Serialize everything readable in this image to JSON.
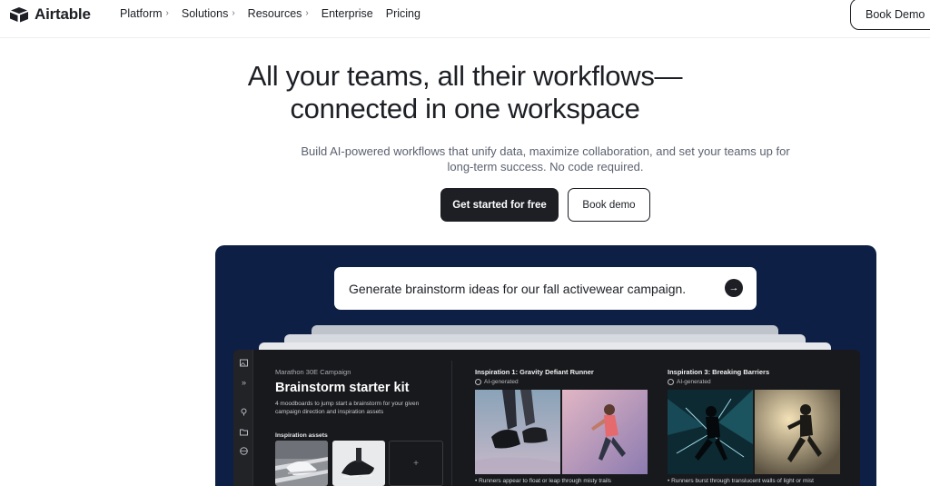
{
  "nav": {
    "logo_text": "Airtable",
    "items": [
      {
        "label": "Platform",
        "has_chevron": true
      },
      {
        "label": "Solutions",
        "has_chevron": true
      },
      {
        "label": "Resources",
        "has_chevron": true
      },
      {
        "label": "Enterprise",
        "has_chevron": false
      },
      {
        "label": "Pricing",
        "has_chevron": false
      }
    ],
    "chevron": "›",
    "book_demo": "Book Demo"
  },
  "hero": {
    "headline_line1": "All your teams, all their workflows—",
    "headline_line2": "connected in one workspace",
    "subhead": "Build AI-powered workflows that unify data, maximize collaboration, and set your teams up for long-term success. No code required.",
    "cta_primary": "Get started for free",
    "cta_secondary": "Book demo"
  },
  "demo": {
    "prompt": "Generate brainstorm ideas for our fall activewear campaign.",
    "send_icon": "→",
    "app": {
      "breadcrumb": "Marathon 30E Campaign",
      "title": "Brainstorm starter kit",
      "description": "4 moodboards to jump start a brainstorm for your given campaign direction and inspiration assets",
      "assets_label": "Inspiration assets",
      "add_icon": "+",
      "inspirations": [
        {
          "title": "Inspiration 1: Gravity Defiant Runner",
          "badge": "AI-generated",
          "bullet": "• Runners appear to float or leap through misty trails"
        },
        {
          "title": "Inspiration 3: Breaking Barriers",
          "badge": "AI-generated",
          "bullet": "• Runners burst through translucent walls of light or mist"
        }
      ]
    }
  },
  "colors": {
    "text_dark": "#1d1f25",
    "panel_navy": "#0e1f46",
    "app_bg": "#18191c"
  }
}
